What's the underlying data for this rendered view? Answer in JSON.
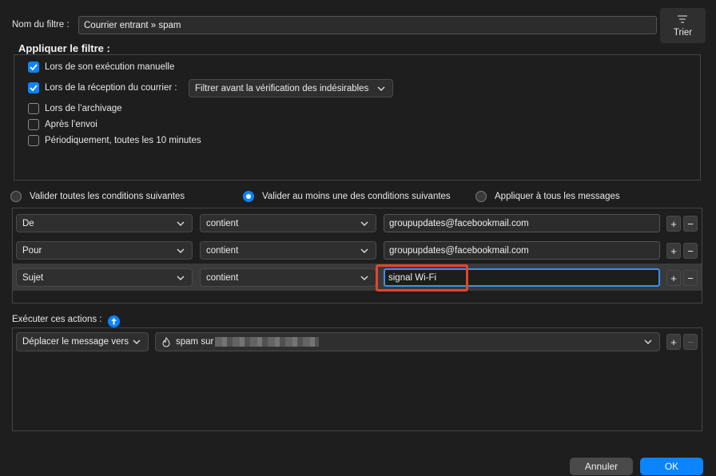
{
  "filter_name": {
    "label": "Nom du filtre :",
    "value": "Courrier entrant » spam"
  },
  "sort_button": {
    "label": "Trier",
    "icon": "sort-lines-icon"
  },
  "apply_filter": {
    "heading": "Appliquer le filtre :",
    "options": [
      {
        "label": "Lors de son exécution manuelle",
        "checked": true
      },
      {
        "label": "Lors de la réception du courrier :",
        "checked": true
      },
      {
        "label": "Lors de l’archivage",
        "checked": false
      },
      {
        "label": "Après l’envoi",
        "checked": false
      },
      {
        "label": "Périodiquement, toutes les 10 minutes",
        "checked": false
      }
    ],
    "reception_select": "Filtrer avant la vérification des indésirables"
  },
  "match_mode": {
    "options": [
      "Valider toutes les conditions suivantes",
      "Valider au moins une des conditions suivantes",
      "Appliquer à tous les messages"
    ],
    "selected_index": 1
  },
  "conditions": [
    {
      "field": "De",
      "operator": "contient",
      "value": "groupupdates@facebookmail.com"
    },
    {
      "field": "Pour",
      "operator": "contient",
      "value": "groupupdates@facebookmail.com"
    },
    {
      "field": "Sujet",
      "operator": "contient",
      "value": "signal Wi-Fi"
    }
  ],
  "actions": {
    "label": "Exécuter ces actions :",
    "action_select": "Déplacer le message vers",
    "folder_value": "spam sur",
    "folder_icon": "flame-folder-icon"
  },
  "buttons": {
    "cancel": "Annuler",
    "ok": "OK"
  },
  "colors": {
    "accent": "#0a84ff",
    "highlight": "#e5442b"
  }
}
